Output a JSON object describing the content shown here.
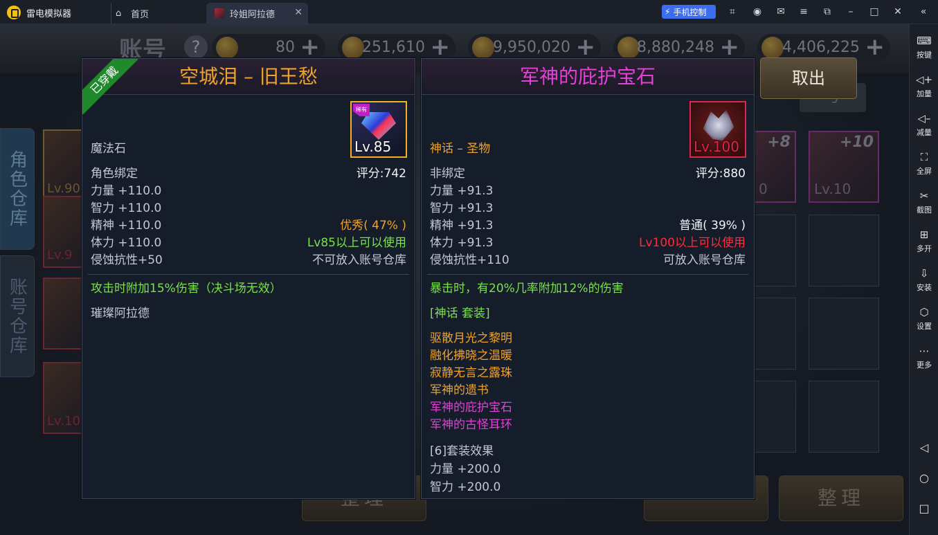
{
  "window": {
    "app_title": "雷电模拟器",
    "tabs": [
      {
        "label": "首页"
      },
      {
        "label": "玲姐阿拉德"
      }
    ],
    "phone_control_label": "手机控制"
  },
  "sidebar": {
    "items": [
      {
        "icon": "keyboard-icon",
        "label": "按键"
      },
      {
        "icon": "volume-up-icon",
        "label": "加量"
      },
      {
        "icon": "volume-down-icon",
        "label": "减量"
      },
      {
        "icon": "fullscreen-icon",
        "label": "全屏"
      },
      {
        "icon": "scissors-icon",
        "label": "截图"
      },
      {
        "icon": "multi-open-icon",
        "label": "多开"
      },
      {
        "icon": "apk-icon",
        "label": "安装"
      },
      {
        "icon": "settings-icon",
        "label": "设置"
      },
      {
        "icon": "more-icon",
        "label": "更多"
      }
    ]
  },
  "game": {
    "account_title": "账号",
    "resources": [
      "80",
      "251,610",
      "9,950,020",
      "8,880,248",
      "4,406,225"
    ],
    "left_tabs": [
      "角色仓库",
      "账号仓库"
    ],
    "takeout_label": "取出",
    "bottom_buttons": [
      "整理",
      "整理"
    ],
    "bg_levels": {
      "lv90": "Lv.90",
      "lv9x": "Lv.9",
      "lv10x": "Lv.10",
      "lv0": "0",
      "lv10": "Lv.10",
      "plus8": "+8",
      "plus10": "+10"
    }
  },
  "equipped_panel": {
    "title": "空城泪 – 旧王愁",
    "worn_badge": "已穿戴",
    "icon_tag": "稀有",
    "icon_level": "Lv.85",
    "type": "魔法石",
    "bind": "角色绑定",
    "score": "评分:742",
    "stats": [
      {
        "label": "力量 +110.0",
        "right": ""
      },
      {
        "label": "智力 +110.0",
        "right": ""
      },
      {
        "label": "精神 +110.0",
        "right": "优秀( 47% )"
      },
      {
        "label": "体力 +110.0",
        "right": "Lv85以上可以使用"
      },
      {
        "label": "侵蚀抗性+50",
        "right": "不可放入账号仓库"
      }
    ],
    "effect": "攻击时附加15%伤害（决斗场无效）",
    "origin": "璀璨阿拉德"
  },
  "compare_panel": {
    "title": "军神的庇护宝石",
    "icon_level": "Lv.100",
    "type": "神话 – 圣物",
    "bind": "非绑定",
    "score": "评分:880",
    "stats": [
      {
        "label": "力量 +91.3",
        "right": ""
      },
      {
        "label": "智力 +91.3",
        "right": ""
      },
      {
        "label": "精神 +91.3",
        "right": "普通( 39% )"
      },
      {
        "label": "体力 +91.3",
        "right": "Lv100以上可以使用"
      },
      {
        "label": "侵蚀抗性+110",
        "right": "可放入账号仓库"
      }
    ],
    "effect": "暴击时，有20%几率附加12%的伤害",
    "set_title": "[神话 套装]",
    "set_items": [
      "驱散月光之黎明",
      "融化拂晓之温暖",
      "寂静无言之露珠",
      "军神的遗书",
      "军神的庇护宝石",
      "军神的古怪耳环"
    ],
    "set_effect_title": "[6]套装效果",
    "set_effects": [
      "力量 +200.0",
      "智力 +200.0"
    ]
  }
}
